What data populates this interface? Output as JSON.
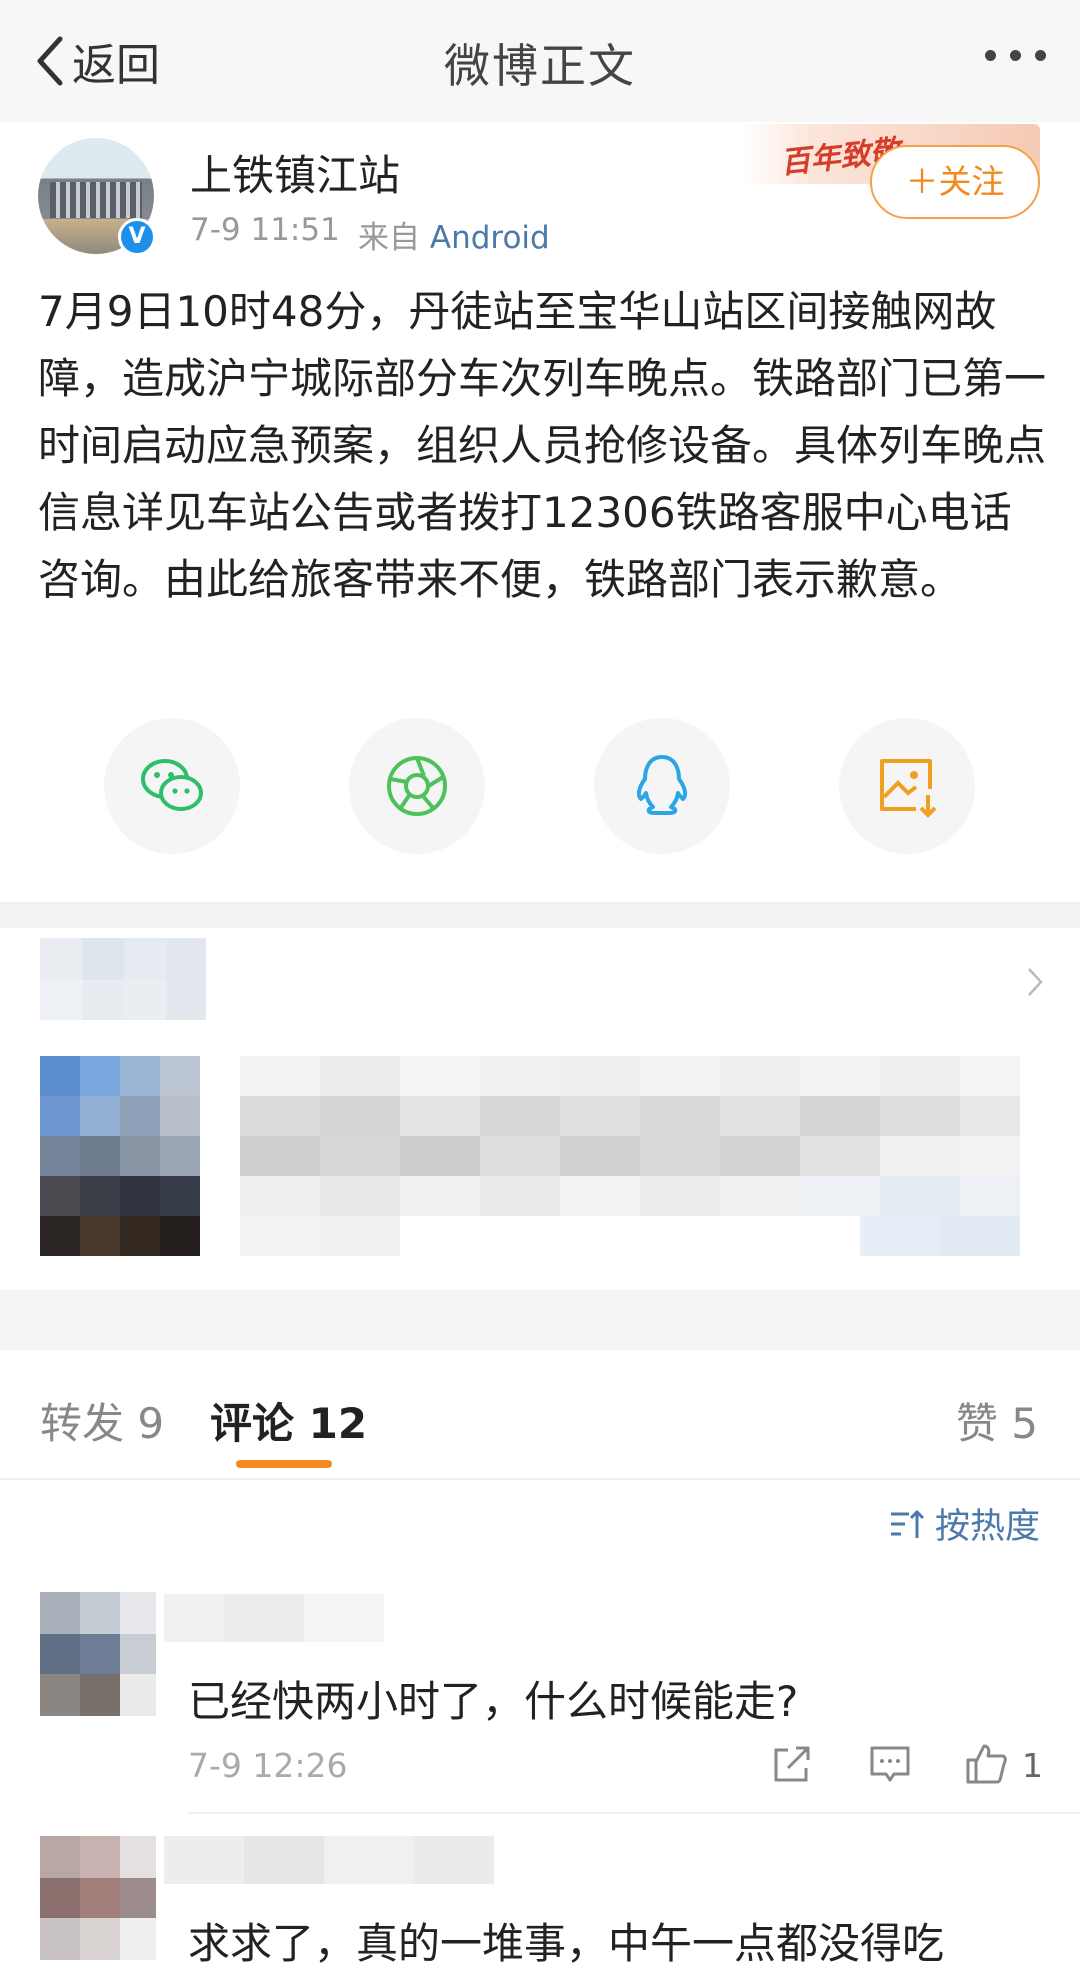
{
  "nav": {
    "back_label": "返回",
    "title": "微博正文",
    "more_icon": "more-dots-icon"
  },
  "post": {
    "author": "上铁镇江站",
    "time": "7-9 11:51",
    "source_prefix": "来自",
    "source_app": "Android",
    "verified": "V",
    "banner_text": "百年致敬",
    "follow_label": "＋关注",
    "text": "7月9日10时48分，丹徒站至宝华山站区间接触网故障，造成沪宁城际部分车次列车晚点。铁路部门已第一时间启动应急预案，组织人员抢修设备。具体列车晚点信息详见车站公告或者拨打12306铁路客服中心电话咨询。由此给旅客带来不便，铁路部门表示歉意。"
  },
  "share_icons": [
    "wechat-icon",
    "moments-icon",
    "qq-icon",
    "save-image-icon"
  ],
  "share_colors": {
    "wechat": "#2fbf6a",
    "moments": "#4cc25a",
    "qq": "#2aa6e8",
    "save": "#f0a020"
  },
  "tabs": {
    "repost": "转发 9",
    "comment": "评论 12",
    "like": "赞 5",
    "accent": "#f28a1d"
  },
  "sort_label": "按热度",
  "comments": [
    {
      "text": "已经快两小时了，什么时候能走?",
      "time": "7-9 12:26",
      "likes": "1"
    },
    {
      "text": "求求了，真的一堆事，中午一点都没得吃"
    }
  ]
}
